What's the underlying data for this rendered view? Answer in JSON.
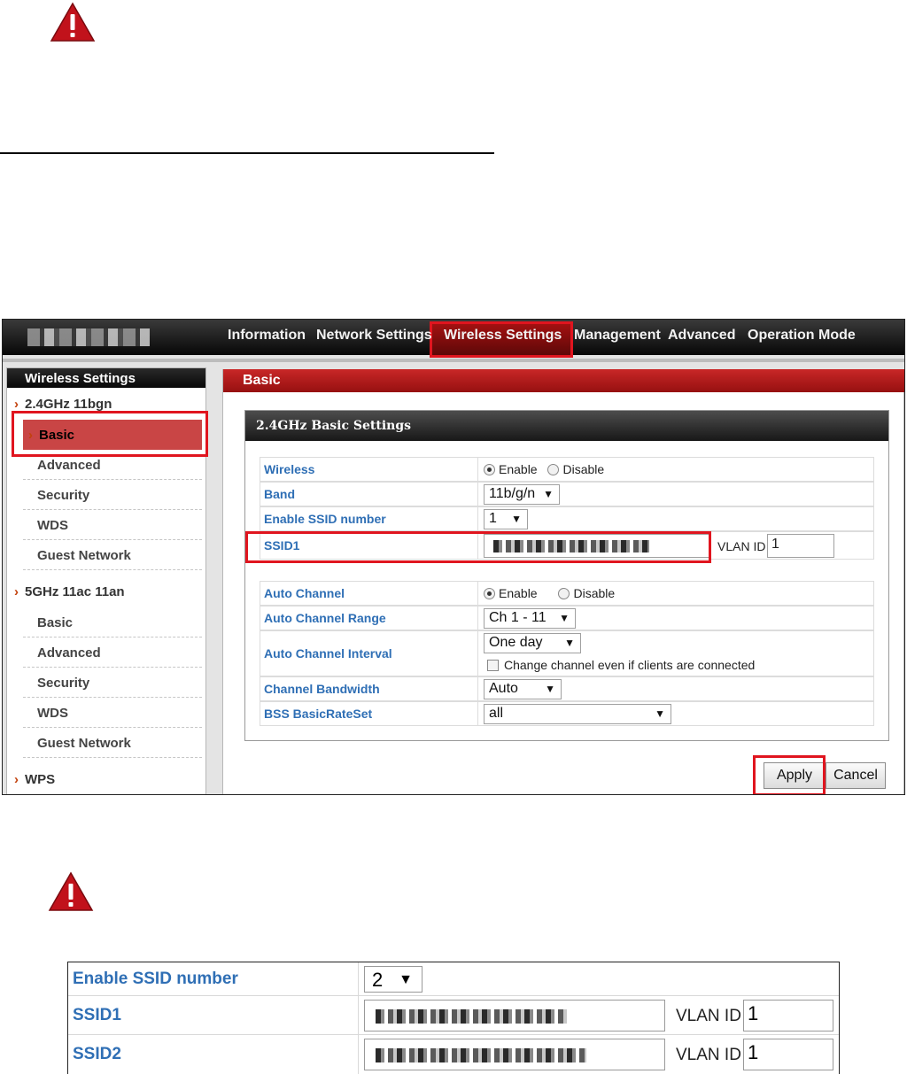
{
  "doc": {
    "warning_icon": "warning-triangle-icon"
  },
  "nav": {
    "items": [
      "Information",
      "Network Settings",
      "Wireless Settings",
      "Management",
      "Advanced",
      "Operation Mode"
    ],
    "active": "Wireless Settings"
  },
  "sidebar": {
    "title": "Wireless Settings",
    "groups": [
      {
        "label": "2.4GHz 11bgn",
        "items": [
          "Basic",
          "Advanced",
          "Security",
          "WDS",
          "Guest Network"
        ]
      },
      {
        "label": "5GHz 11ac 11an",
        "items": [
          "Basic",
          "Advanced",
          "Security",
          "WDS",
          "Guest Network"
        ]
      },
      {
        "label": "WPS"
      }
    ],
    "active_item": "Basic"
  },
  "content": {
    "title": "Basic",
    "panel_title": "2.4GHz Basic Settings",
    "rows": {
      "wireless": {
        "label": "Wireless",
        "opt1": "Enable",
        "opt2": "Disable",
        "selected": "Enable"
      },
      "band": {
        "label": "Band",
        "value": "11b/g/n"
      },
      "ssid_number": {
        "label": "Enable SSID number",
        "value": "1"
      },
      "ssid1": {
        "label": "SSID1",
        "vlan_label": "VLAN ID",
        "vlan_value": "1"
      },
      "auto_channel": {
        "label": "Auto Channel",
        "opt1": "Enable",
        "opt2": "Disable",
        "selected": "Enable"
      },
      "auto_channel_range": {
        "label": "Auto Channel Range",
        "value": "Ch 1 - 11"
      },
      "auto_channel_interval": {
        "label": "Auto Channel Interval",
        "value": "One day",
        "checkbox_label": "Change channel even if clients are connected"
      },
      "channel_bandwidth": {
        "label": "Channel Bandwidth",
        "value": "Auto"
      },
      "bss_basic_rate_set": {
        "label": "BSS BasicRateSet",
        "value": "all"
      }
    },
    "apply_label": "Apply",
    "cancel_label": "Cancel"
  },
  "lower_table": {
    "ssid_number": {
      "label": "Enable SSID number",
      "value": "2"
    },
    "ssid1": {
      "label": "SSID1",
      "vlan_label": "VLAN ID",
      "vlan_value": "1"
    },
    "ssid2": {
      "label": "SSID2",
      "vlan_label": "VLAN ID",
      "vlan_value": "1"
    }
  },
  "colors": {
    "accent_red": "#e0151f",
    "label_blue": "#2f6fb5",
    "header_red": "#c92727"
  }
}
